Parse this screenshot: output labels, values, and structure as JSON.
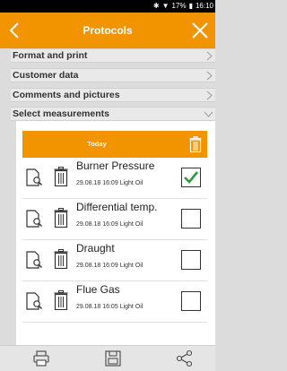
{
  "status_bar": {
    "battery": "17%",
    "time": "16:10"
  },
  "header": {
    "title": "Protocols"
  },
  "sections": [
    {
      "label": "Format and print"
    },
    {
      "label": "Customer data"
    },
    {
      "label": "Comments and pictures"
    },
    {
      "label": "Select measurements"
    }
  ],
  "group": {
    "label": "Today"
  },
  "measurements": [
    {
      "name": "Burner Pressure",
      "date": "29.08.18",
      "time": "16:09",
      "fuel": "Light Oil",
      "checked": true
    },
    {
      "name": "Differential temp.",
      "date": "29.08.18",
      "time": "16:09",
      "fuel": "Light Oil",
      "checked": false
    },
    {
      "name": "Draught",
      "date": "29.08.18",
      "time": "16:09",
      "fuel": "Light Oil",
      "checked": false
    },
    {
      "name": "Flue Gas",
      "date": "29.08.18",
      "time": "16:05",
      "fuel": "Light Oil",
      "checked": false
    }
  ],
  "colors": {
    "accent": "#f29400",
    "check": "#2e9a3c"
  },
  "icons": {
    "back": "chevron-left-icon",
    "close": "close-icon",
    "doc": "document-search-icon",
    "trash": "trash-icon",
    "print": "print-icon",
    "save": "save-icon",
    "share": "share-icon"
  }
}
